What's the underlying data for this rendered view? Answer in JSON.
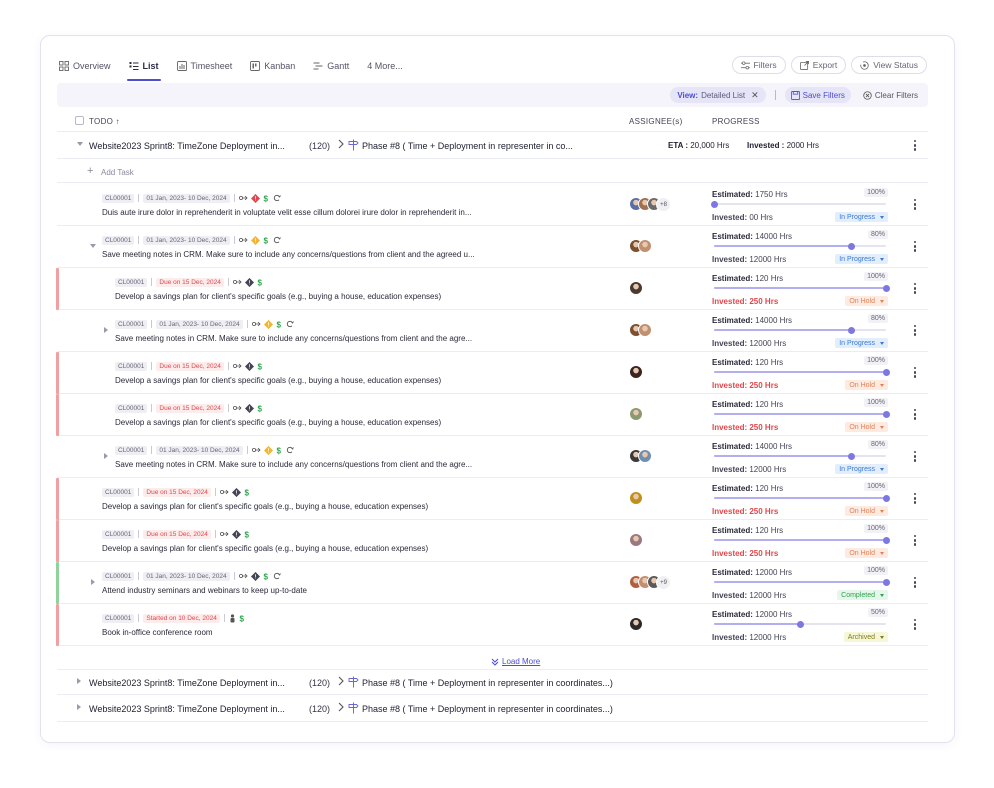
{
  "tabs": [
    {
      "label": "Overview",
      "icon": "grid-icon"
    },
    {
      "label": "List",
      "icon": "list-icon",
      "active": true
    },
    {
      "label": "Timesheet",
      "icon": "timesheet-icon"
    },
    {
      "label": "Kanban",
      "icon": "kanban-icon"
    },
    {
      "label": "Gantt",
      "icon": "gantt-icon"
    },
    {
      "label": "4 More...",
      "icon": ""
    }
  ],
  "actions": {
    "filters": "Filters",
    "export": "Export",
    "view_status": "View Status"
  },
  "filterbar": {
    "view_key": "View:",
    "view_value": "Detailed List",
    "save": "Save Filters",
    "clear": "Clear Filters"
  },
  "columns": {
    "todo": "TODO ↑",
    "assignees": "ASSIGNEE(s)",
    "progress": "PROGRESS"
  },
  "group_main": {
    "name": "Website2023 Sprint8: TimeZone Deployment in...",
    "count": "(120)",
    "phase": "Phase #8 ( Time + Deployment in representer in  co...",
    "eta_label": "ETA :",
    "eta_value": "20,000 Hrs",
    "invested_label": "Invested :",
    "invested_value": "2000 Hrs"
  },
  "add_task": "Add Task",
  "rows": [
    {
      "id": "CL00001",
      "date": "01 Jan, 2023- 10 Dec, 2024",
      "date_red": false,
      "title": "Duis aute irure dolor in reprehenderit in voluptate velit esse cillum dolorei irure dolor in reprehenderit in...",
      "indent": 0,
      "caret": "",
      "bar": "",
      "avatars": [
        "#5a6fa8",
        "#a07050",
        "#6a6a6a"
      ],
      "more": "+8",
      "est_label": "Estimated:",
      "est": "1750 Hrs",
      "pct": "100%",
      "progress": 0.0,
      "invested_label": "Invested:",
      "invested": "00 Hrs",
      "inv_red": false,
      "status": "In Progress",
      "status_class": "st-ip",
      "icons": [
        "branch",
        "alert-red",
        "dollar",
        "sync"
      ]
    },
    {
      "id": "CL00001",
      "date": "01 Jan, 2023- 10 Dec, 2024",
      "date_red": false,
      "title": "Save meeting notes in CRM. Make sure to include any concerns/questions from client and the agreed u...",
      "indent": 0,
      "caret": "down",
      "bar": "",
      "avatars": [
        "#7a5030",
        "#c09070"
      ],
      "more": "",
      "est_label": "Estimated:",
      "est": "14000 Hrs",
      "pct": "80%",
      "progress": 0.8,
      "invested_label": "Invested:",
      "invested": "12000 Hrs",
      "inv_red": false,
      "status": "In Progress",
      "status_class": "st-ip",
      "icons": [
        "branch",
        "alert-yellow",
        "dollar",
        "sync"
      ]
    },
    {
      "id": "CL00001",
      "date": "Due on 15 Dec, 2024",
      "date_red": true,
      "title": "Develop a savings plan for client's specific goals (e.g., buying a house, education expenses)",
      "indent": 1,
      "caret": "",
      "bar": "#f0a0a0",
      "avatars": [
        "#4a3a30"
      ],
      "more": "",
      "est_label": "Estimated:",
      "est": "120 Hrs",
      "pct": "100%",
      "progress": 1.0,
      "invested_label": "Invested:",
      "invested": "250 Hrs",
      "inv_red": true,
      "status": "On Hold",
      "status_class": "st-oh",
      "icons": [
        "branch",
        "alert-dark",
        "dollar"
      ]
    },
    {
      "id": "CL00001",
      "date": "01 Jan, 2023- 10 Dec, 2024",
      "date_red": false,
      "title": "Save meeting notes in CRM. Make sure to include any concerns/questions from client and the agre...",
      "indent": 1,
      "caret": "right",
      "bar": "",
      "avatars": [
        "#7a5030",
        "#c09070"
      ],
      "more": "",
      "est_label": "Estimated:",
      "est": "14000 Hrs",
      "pct": "80%",
      "progress": 0.8,
      "invested_label": "Invested:",
      "invested": "12000 Hrs",
      "inv_red": false,
      "status": "In Progress",
      "status_class": "st-ip",
      "icons": [
        "branch",
        "alert-yellow",
        "dollar",
        "sync"
      ]
    },
    {
      "id": "CL00001",
      "date": "Due on 15 Dec, 2024",
      "date_red": true,
      "title": "Develop a savings plan for client's specific goals (e.g., buying a house, education expenses)",
      "indent": 1,
      "caret": "",
      "bar": "#f0a0a0",
      "avatars": [
        "#3a2520"
      ],
      "more": "",
      "est_label": "Estimated:",
      "est": "120 Hrs",
      "pct": "100%",
      "progress": 1.0,
      "invested_label": "Invested:",
      "invested": "250 Hrs",
      "inv_red": true,
      "status": "On Hold",
      "status_class": "st-oh",
      "icons": [
        "branch",
        "alert-dark",
        "dollar"
      ]
    },
    {
      "id": "CL00001",
      "date": "Due on 15 Dec, 2024",
      "date_red": true,
      "title": "Develop a savings plan for client's specific goals (e.g., buying a house, education expenses)",
      "indent": 1,
      "caret": "",
      "bar": "#f0a0a0",
      "avatars": [
        "#8a9a70"
      ],
      "more": "",
      "est_label": "Estimated:",
      "est": "120 Hrs",
      "pct": "100%",
      "progress": 1.0,
      "invested_label": "Invested:",
      "invested": "250 Hrs",
      "inv_red": true,
      "status": "On Hold",
      "status_class": "st-oh",
      "icons": [
        "branch",
        "alert-dark",
        "dollar"
      ]
    },
    {
      "id": "CL00001",
      "date": "01 Jan, 2023- 10 Dec, 2024",
      "date_red": false,
      "title": "Save meeting notes in CRM. Make sure to include any concerns/questions from client and the agre...",
      "indent": 1,
      "caret": "right",
      "bar": "",
      "avatars": [
        "#3a3a3a",
        "#7090b0"
      ],
      "more": "",
      "est_label": "Estimated:",
      "est": "14000 Hrs",
      "pct": "80%",
      "progress": 0.8,
      "invested_label": "Invested:",
      "invested": "12000 Hrs",
      "inv_red": false,
      "status": "In Progress",
      "status_class": "st-ip",
      "icons": [
        "branch",
        "alert-yellow",
        "dollar",
        "sync"
      ]
    },
    {
      "id": "CL00001",
      "date": "Due on 15 Dec, 2024",
      "date_red": true,
      "title": "Develop a savings plan for client's specific goals (e.g., buying a house, education expenses)",
      "indent": 0,
      "caret": "",
      "bar": "#f0a0a0",
      "avatars": [
        "#c0901a"
      ],
      "more": "",
      "est_label": "Estimated:",
      "est": "120 Hrs",
      "pct": "100%",
      "progress": 1.0,
      "invested_label": "Invested:",
      "invested": "250 Hrs",
      "inv_red": true,
      "status": "On Hold",
      "status_class": "st-oh",
      "icons": [
        "branch",
        "alert-dark",
        "dollar"
      ]
    },
    {
      "id": "CL00001",
      "date": "Due on 15 Dec, 2024",
      "date_red": true,
      "title": "Develop a savings plan for client's specific goals (e.g., buying a house, education expenses)",
      "indent": 0,
      "caret": "",
      "bar": "#f0a0a0",
      "avatars": [
        "#9a7a80"
      ],
      "more": "",
      "est_label": "Estimated:",
      "est": "120 Hrs",
      "pct": "100%",
      "progress": 1.0,
      "invested_label": "Invested:",
      "invested": "250 Hrs",
      "inv_red": true,
      "status": "On Hold",
      "status_class": "st-oh",
      "icons": [
        "branch",
        "alert-dark",
        "dollar"
      ]
    },
    {
      "id": "CL00001",
      "date": "01 Jan, 2023- 10 Dec, 2024",
      "date_red": false,
      "title": "Attend industry seminars and webinars to keep up-to-date",
      "indent": 0,
      "caret": "right",
      "bar": "#8fd39a",
      "avatars": [
        "#b06040",
        "#c09070",
        "#5a5a5a"
      ],
      "more": "+9",
      "est_label": "Estimated:",
      "est": "12000 Hrs",
      "pct": "100%",
      "progress": 1.0,
      "invested_label": "Invested:",
      "invested": "12000 Hrs",
      "inv_red": false,
      "status": "Completed",
      "status_class": "st-co",
      "icons": [
        "branch",
        "alert-dark",
        "dollar",
        "sync"
      ]
    },
    {
      "id": "CL00001",
      "date": "Started on 10 Dec, 2024",
      "date_red": true,
      "title": "Book in-office conference room",
      "indent": 0,
      "caret": "",
      "bar": "#f0a0a0",
      "avatars": [
        "#2a2a2a"
      ],
      "more": "",
      "est_label": "Estimated:",
      "est": "12000 Hrs",
      "pct": "50%",
      "progress": 0.5,
      "invested_label": "Invested:",
      "invested": "12000 Hrs",
      "inv_red": false,
      "status": "Archived",
      "status_class": "st-ar",
      "icons": [
        "person",
        "dollar"
      ]
    }
  ],
  "load_more": "Load More",
  "groups_collapsed": [
    {
      "name": "Website2023 Sprint8: TimeZone Deployment in...",
      "count": "(120)",
      "phase": "Phase #8 ( Time + Deployment in representer in  coordinates...)"
    },
    {
      "name": "Website2023 Sprint8: TimeZone Deployment in...",
      "count": "(120)",
      "phase": "Phase #8 ( Time + Deployment in representer in  coordinates...)"
    }
  ],
  "colors": {
    "accent": "#4b4ecf",
    "danger": "#e0474c",
    "success": "#2ea44f"
  }
}
